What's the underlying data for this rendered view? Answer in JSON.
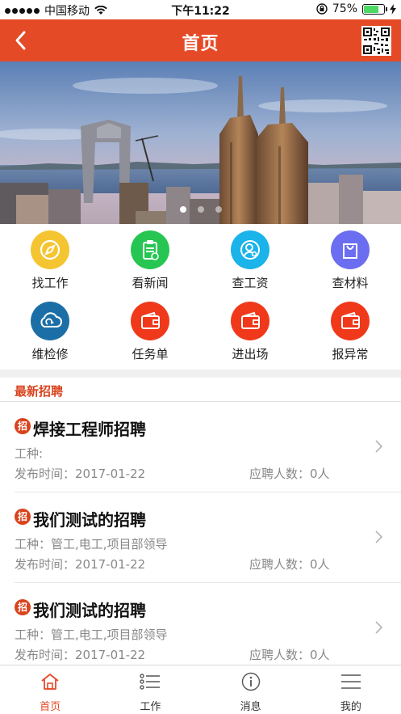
{
  "status": {
    "carrier": "中国移动",
    "time": "下午11:22",
    "battery": "75%",
    "battery_level": 0.75
  },
  "nav": {
    "title": "首页"
  },
  "banner": {
    "slide_count": 3,
    "active_slide": 1
  },
  "grid": [
    {
      "label": "找工作",
      "icon": "compass-icon",
      "color": "#f5c531"
    },
    {
      "label": "看新闻",
      "icon": "clipboard-icon",
      "color": "#27c653"
    },
    {
      "label": "查工资",
      "icon": "user-search-icon",
      "color": "#1ab3ea"
    },
    {
      "label": "查材料",
      "icon": "shopping-bag-icon",
      "color": "#6b6ef0"
    },
    {
      "label": "维检修",
      "icon": "cloud-sync-icon",
      "color": "#1c6fa6"
    },
    {
      "label": "任务单",
      "icon": "wallet-icon",
      "color": "#f0391b"
    },
    {
      "label": "进出场",
      "icon": "wallet-icon",
      "color": "#f0391b"
    },
    {
      "label": "报异常",
      "icon": "wallet-icon",
      "color": "#f0391b"
    }
  ],
  "section": {
    "title": "最新招聘"
  },
  "jobs": [
    {
      "badge": "招",
      "title": "焊接工程师招聘",
      "type": "工种:",
      "date": "发布时间：2017-01-22",
      "count": "应聘人数：0人"
    },
    {
      "badge": "招",
      "title": "我们测试的招聘",
      "type": "工种：管工,电工,项目部领导",
      "date": "发布时间：2017-01-22",
      "count": "应聘人数：0人"
    },
    {
      "badge": "招",
      "title": "我们测试的招聘",
      "type": "工种：管工,电工,项目部领导",
      "date": "发布时间：2017-01-22",
      "count": "应聘人数：0人"
    }
  ],
  "tabs": [
    {
      "label": "首页",
      "icon": "home-icon",
      "active": true
    },
    {
      "label": "工作",
      "icon": "list-icon",
      "active": false
    },
    {
      "label": "消息",
      "icon": "info-icon",
      "active": false
    },
    {
      "label": "我的",
      "icon": "menu-icon",
      "active": false
    }
  ],
  "colors": {
    "brand": "#e54a26",
    "accent": "#d9431d"
  }
}
